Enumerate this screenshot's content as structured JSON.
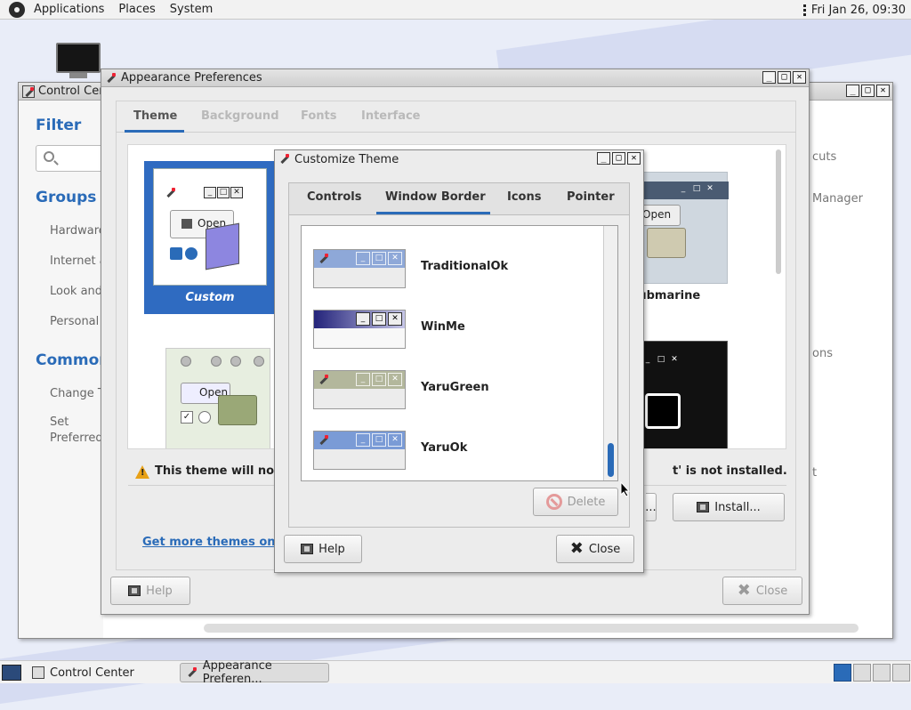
{
  "top_panel": {
    "menus": [
      "Applications",
      "Places",
      "System"
    ],
    "clock": "Fri Jan 26, 09:30"
  },
  "control_center": {
    "title": "Control Center",
    "filter_heading": "Filter",
    "groups_heading": "Groups",
    "groups": [
      "Hardware",
      "Internet and Network",
      "Look and Feel",
      "Personal"
    ],
    "common_heading": "Common",
    "common_items": [
      "Change Theme",
      "Set Preferred Applications"
    ],
    "right_partial": [
      "cuts",
      "Manager",
      "ons",
      "t"
    ]
  },
  "appearance": {
    "title": "Appearance Preferences",
    "tabs": [
      "Theme",
      "Background",
      "Fonts",
      "Interface"
    ],
    "active_tab": "Theme",
    "themes": {
      "custom_label": "Custom",
      "submarine_label": "Submarine"
    },
    "warning_text": "This theme will not lo",
    "warning_right": "t' is not installed.",
    "link_text": "Get more themes onlin",
    "install_button": "Install...",
    "partial_button": "...",
    "help_button": "Help",
    "close_button": "Close",
    "thumb_open_label": "Open"
  },
  "customize": {
    "title": "Customize Theme",
    "tabs": [
      "Controls",
      "Window Border",
      "Icons",
      "Pointer"
    ],
    "active_tab": "Window Border",
    "borders": [
      {
        "name": "TraditionalOk",
        "color": "#8ea8d8"
      },
      {
        "name": "WinMe",
        "color": "#23237a"
      },
      {
        "name": "YaruGreen",
        "color": "#b3b79c"
      },
      {
        "name": "YaruOk",
        "color": "#7a9bd6"
      }
    ],
    "delete_button": "Delete",
    "help_button": "Help",
    "close_button": "Close"
  },
  "taskbar": {
    "tasks": [
      "Control Center",
      "Appearance Preferen..."
    ]
  },
  "colors": {
    "accent": "#2a6bb8",
    "selected_theme_bg": "#2f6bc1",
    "warning": "#e8a117"
  }
}
